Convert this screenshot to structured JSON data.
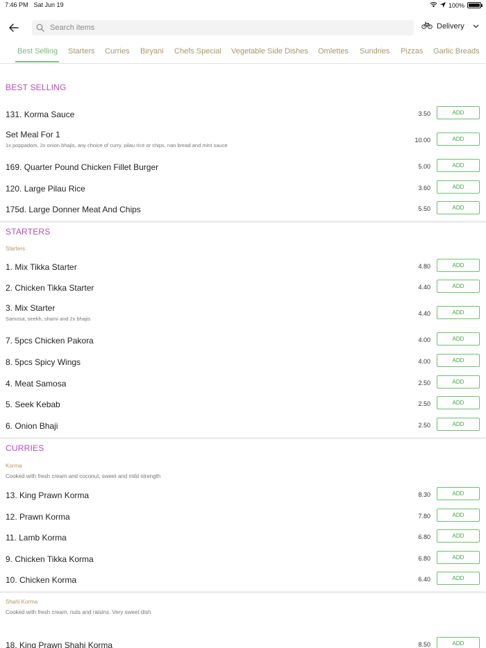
{
  "status": {
    "time": "7:46 PM",
    "date": "Sat Jun 19",
    "battery": "100%",
    "battery_level": 1.0
  },
  "header": {
    "search_placeholder": "Search items",
    "delivery_label": "Delivery"
  },
  "tabs": [
    {
      "label": "Best Selling",
      "active": true
    },
    {
      "label": "Starters"
    },
    {
      "label": "Curries"
    },
    {
      "label": "Biryani"
    },
    {
      "label": "Chefs Special"
    },
    {
      "label": "Vegetable Side Dishes"
    },
    {
      "label": "Omlettes"
    },
    {
      "label": "Sundries"
    },
    {
      "label": "Pizzas"
    },
    {
      "label": "Garlic Breads"
    }
  ],
  "add_label": "ADD",
  "sections": {
    "best_selling": {
      "title": "BEST SELLING",
      "items": [
        {
          "name": "131. Korma Sauce",
          "price": "3.50"
        },
        {
          "name": "Set Meal For 1",
          "desc": "1x poppadom, 2x onion bhajis, any choice of curry, pilau rice or chips, nan bread and mint sauce",
          "price": "10.00"
        },
        {
          "name": "169. Quarter Pound Chicken Fillet Burger",
          "price": "5.00"
        },
        {
          "name": "120. Large Pilau Rice",
          "price": "3.60"
        },
        {
          "name": "175d. Large Donner Meat And Chips",
          "price": "5.50"
        }
      ]
    },
    "starters": {
      "title": "STARTERS",
      "subcategory": "Starters",
      "items": [
        {
          "name": "1. Mix Tikka Starter",
          "price": "4.80"
        },
        {
          "name": "2. Chicken Tikka Starter",
          "price": "4.40"
        },
        {
          "name": "3. Mix Starter",
          "desc": "Samosa, seekh, shami and 2x bhajis",
          "price": "4.40"
        },
        {
          "name": "7. 5pcs Chicken Pakora",
          "price": "4.00"
        },
        {
          "name": "8. 5pcs Spicy Wings",
          "price": "4.00"
        },
        {
          "name": "4. Meat Samosa",
          "price": "2.50"
        },
        {
          "name": "5. Seek Kebab",
          "price": "2.50"
        },
        {
          "name": "6. Onion Bhaji",
          "price": "2.50"
        }
      ]
    },
    "curries": {
      "title": "CURRIES",
      "korma": {
        "subcategory": "Korma",
        "description": "Cooked with fresh cream and coconut, sweet and mild strength",
        "items": [
          {
            "name": "13. King Prawn Korma",
            "price": "8.30"
          },
          {
            "name": "12. Prawn Korma",
            "price": "7.80"
          },
          {
            "name": "11. Lamb Korma",
            "price": "6.80"
          },
          {
            "name": "9. Chicken Tikka Korma",
            "price": "6.80"
          },
          {
            "name": "10. Chicken Korma",
            "price": "6.40"
          }
        ]
      },
      "shahi_korma": {
        "subcategory": "Shahi Korma",
        "description": "Cooked with fresh cream, nuts and raisins. Very sweet dish",
        "items": [
          {
            "name": "18. King Prawn Shahi Korma",
            "price": "8.50"
          }
        ]
      }
    }
  }
}
